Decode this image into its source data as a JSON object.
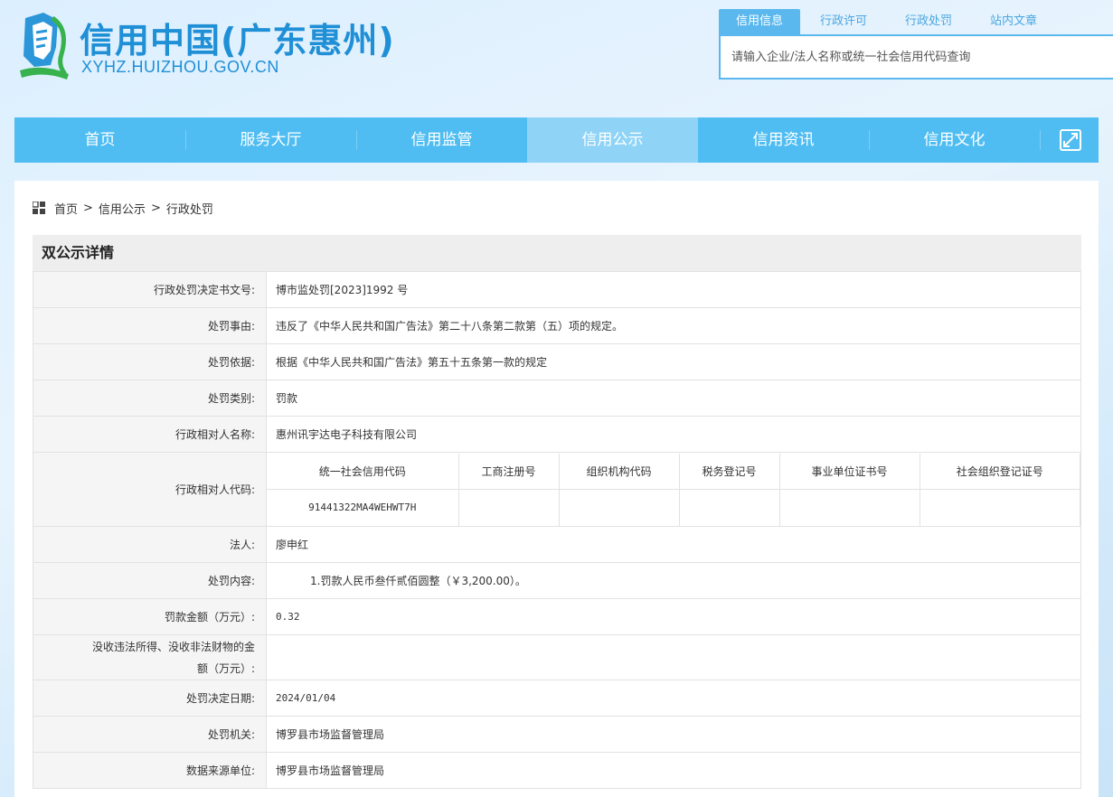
{
  "site": {
    "title": "信用中国(广东惠州)",
    "domain": "XYHZ.HUIZHOU.GOV.CN"
  },
  "search": {
    "tabs": [
      "信用信息",
      "行政许可",
      "行政处罚",
      "站内文章"
    ],
    "placeholder": "请输入企业/法人名称或统一社会信用代码查询"
  },
  "nav": {
    "items": [
      "首页",
      "服务大厅",
      "信用监管",
      "信用公示",
      "信用资讯",
      "信用文化"
    ],
    "active_index": 3
  },
  "breadcrumb": {
    "items": [
      "首页",
      "信用公示",
      "行政处罚"
    ],
    "separator": ">"
  },
  "detail": {
    "title": "双公示详情",
    "rows": [
      {
        "label": "行政处罚决定书文号:",
        "value": "博市监处罚[2023]1992 号"
      },
      {
        "label": "处罚事由:",
        "value": "违反了《中华人民共和国广告法》第二十八条第二款第（五）项的规定。"
      },
      {
        "label": "处罚依据:",
        "value": "根据《中华人民共和国广告法》第五十五条第一款的规定"
      },
      {
        "label": "处罚类别:",
        "value": "罚款"
      },
      {
        "label": "行政相对人名称:",
        "value": "惠州讯宇达电子科技有限公司"
      }
    ],
    "code_row": {
      "label": "行政相对人代码:",
      "headers": [
        "统一社会信用代码",
        "工商注册号",
        "组织机构代码",
        "税务登记号",
        "事业单位证书号",
        "社会组织登记证号"
      ],
      "values": [
        "91441322MA4WEHWT7H",
        "",
        "",
        "",
        "",
        ""
      ]
    },
    "rows2": [
      {
        "label": "法人:",
        "value": "廖申红"
      },
      {
        "label": "处罚内容:",
        "value": "1.罚款人民币叁仟贰佰圆整（￥3,200.00）。"
      },
      {
        "label": "罚款金额（万元）:",
        "value": "0.32"
      },
      {
        "label": "没收违法所得、没收非法财物的金额（万元）:",
        "value": ""
      },
      {
        "label": "处罚决定日期:",
        "value": "2024/01/04"
      },
      {
        "label": "处罚机关:",
        "value": "博罗县市场监督管理局"
      },
      {
        "label": "数据来源单位:",
        "value": "博罗县市场监督管理局"
      }
    ]
  },
  "colors": {
    "brand": "#1f8fd6",
    "nav_bg": "#4fbdf2",
    "nav_active": "#8fd4f7"
  }
}
